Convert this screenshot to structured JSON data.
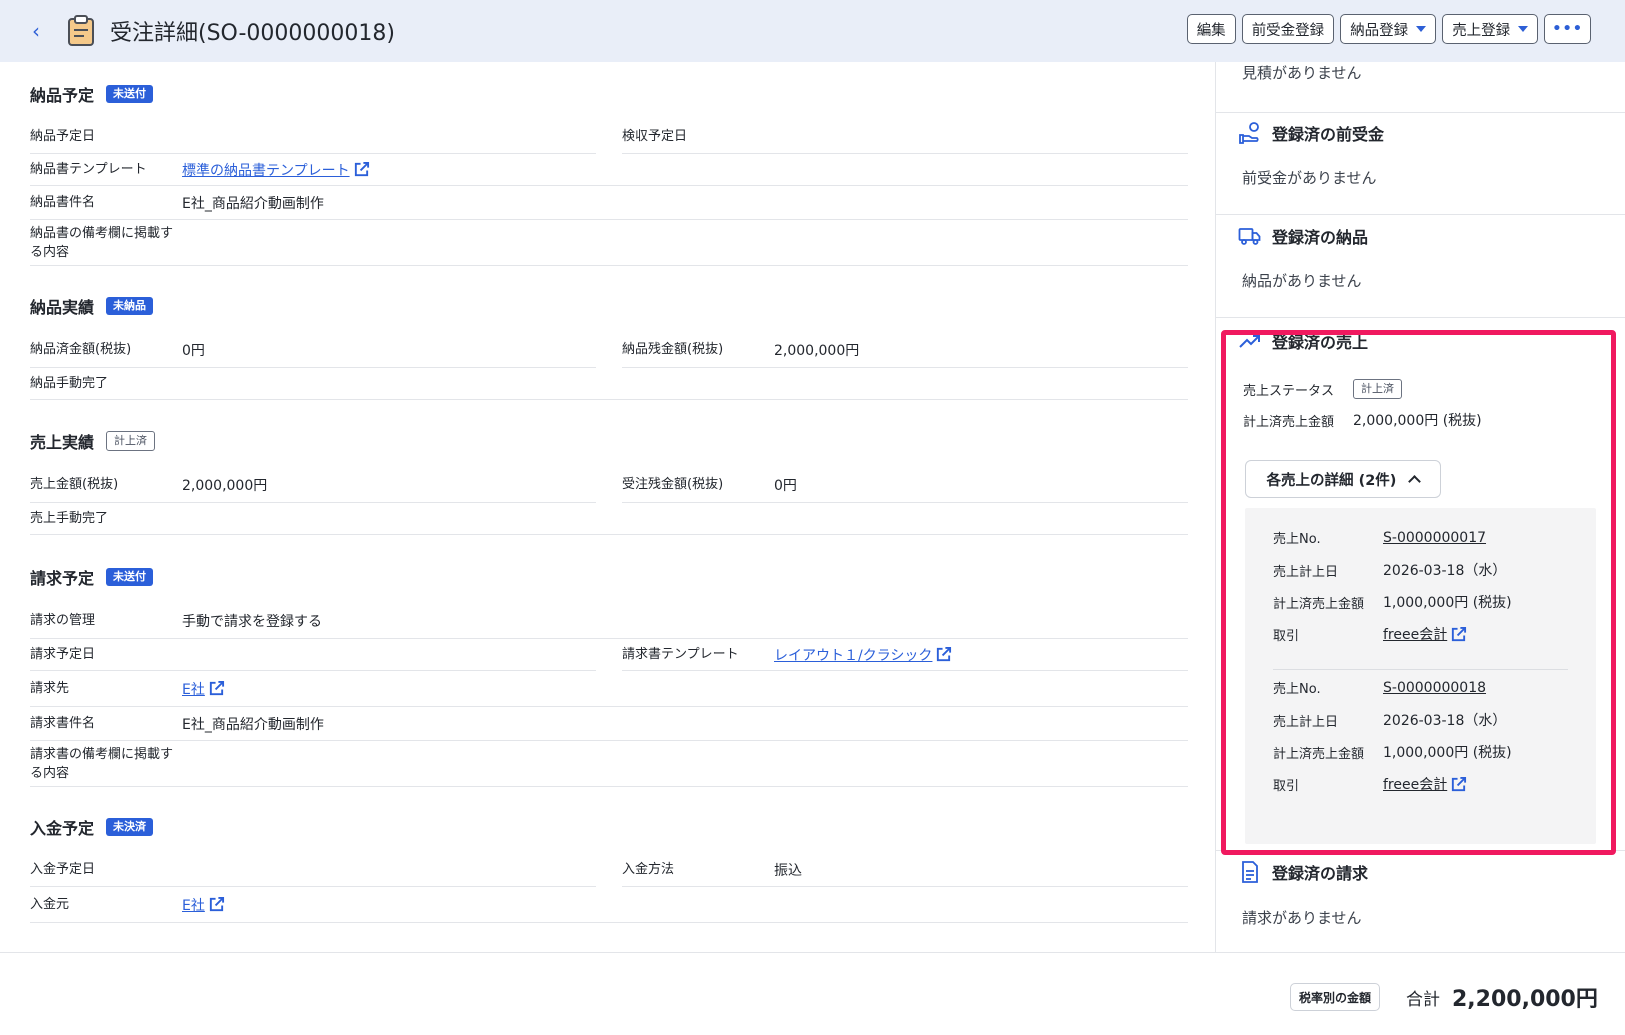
{
  "header": {
    "title": "受注詳細(SO-0000000018)",
    "actions": {
      "edit": "編集",
      "advance": "前受金登録",
      "delivery": "納品登録",
      "sales": "売上登録",
      "more": "•••"
    }
  },
  "delivery_plan": {
    "title": "納品予定",
    "badge": "未送付",
    "fields": {
      "date_label": "納品予定日",
      "date_value": "",
      "inspect_label": "検収予定日",
      "inspect_value": "",
      "template_label": "納品書テンプレート",
      "template_value": "標準の納品書テンプレート",
      "name_label": "納品書件名",
      "name_value": "E社_商品紹介動画制作",
      "remarks_label": "納品書の備考欄に掲載する内容",
      "remarks_value": ""
    }
  },
  "delivery_result": {
    "title": "納品実績",
    "badge": "未納品",
    "fields": {
      "done_label": "納品済金額(税抜)",
      "done_value": "0円",
      "remain_label": "納品残金額(税抜)",
      "remain_value": "2,000,000円",
      "manual_label": "納品手動完了"
    }
  },
  "sales_result": {
    "title": "売上実績",
    "badge": "計上済",
    "fields": {
      "amount_label": "売上金額(税抜)",
      "amount_value": "2,000,000円",
      "remain_label": "受注残金額(税抜)",
      "remain_value": "0円",
      "manual_label": "売上手動完了"
    }
  },
  "billing_plan": {
    "title": "請求予定",
    "badge": "未送付",
    "fields": {
      "manage_label": "請求の管理",
      "manage_value": "手動で請求を登録する",
      "date_label": "請求予定日",
      "template_label": "請求書テンプレート",
      "template_value": "レイアウト１/クラシック",
      "to_label": "請求先",
      "to_value": "E社",
      "name_label": "請求書件名",
      "name_value": "E社_商品紹介動画制作",
      "remarks_label": "請求書の備考欄に掲載する内容"
    }
  },
  "payment_plan": {
    "title": "入金予定",
    "badge": "未決済",
    "fields": {
      "date_label": "入金予定日",
      "method_label": "入金方法",
      "method_value": "振込",
      "from_label": "入金元",
      "from_value": "E社"
    }
  },
  "sidebar": {
    "estimate_empty": "見積がありません",
    "advance": {
      "title": "登録済の前受金",
      "empty": "前受金がありません"
    },
    "delivery": {
      "title": "登録済の納品",
      "empty": "納品がありません"
    },
    "sales": {
      "title": "登録済の売上",
      "status_label": "売上ステータス",
      "status_badge": "計上済",
      "amount_label": "計上済売上金額",
      "amount_value": "2,000,000円 (税抜)",
      "toggle_label": "各売上の詳細 (2件)",
      "items": [
        {
          "no_label": "売上No.",
          "no_value": "S-0000000017",
          "date_label": "売上計上日",
          "date_value": "2026-03-18（水）",
          "amount_label": "計上済売上金額",
          "amount_value": "1,000,000円 (税抜)",
          "deal_label": "取引",
          "deal_value": "freee会計"
        },
        {
          "no_label": "売上No.",
          "no_value": "S-0000000018",
          "date_label": "売上計上日",
          "date_value": "2026-03-18（水）",
          "amount_label": "計上済売上金額",
          "amount_value": "1,000,000円 (税抜)",
          "deal_label": "取引",
          "deal_value": "freee会計"
        }
      ]
    },
    "billing": {
      "title": "登録済の請求",
      "empty": "請求がありません"
    }
  },
  "footer": {
    "tax_button": "税率別の金額",
    "total_label": "合計",
    "total_value": "2,200,000円"
  },
  "colors": {
    "accent": "#2b5fd9",
    "highlight": "#f0195f",
    "header_bg": "#e9eef8"
  }
}
